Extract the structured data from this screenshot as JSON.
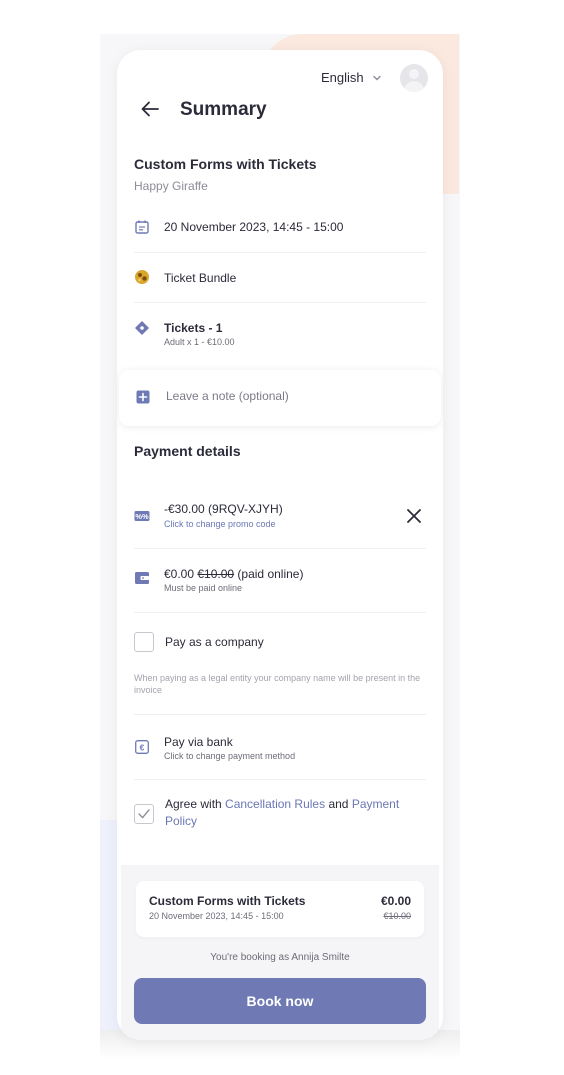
{
  "header": {
    "language": "English",
    "title": "Summary"
  },
  "event": {
    "title": "Custom Forms with Tickets",
    "organizer": "Happy Giraffe",
    "date_time": "20 November 2023, 14:45 - 15:00",
    "bundle": "Ticket Bundle",
    "tickets_label": "Tickets - 1",
    "tickets_detail": "Adult x 1 - €10.00"
  },
  "note": {
    "placeholder": "Leave a note (optional)"
  },
  "payment": {
    "title": "Payment details",
    "promo_value": "-€30.00 (9RQV-XJYH)",
    "promo_sub": "Click to change promo code",
    "price_now": "€0.00",
    "price_old": "€10.00",
    "price_suffix": "(paid online)",
    "price_sub": "Must be paid online",
    "company_label": "Pay as a company",
    "company_note": "When paying as a legal entity your company name will be present in the invoice",
    "method_label": "Pay via bank",
    "method_sub": "Click to change payment method",
    "agree_prefix": "Agree with",
    "agree_link1": "Cancellation Rules",
    "agree_and": "and",
    "agree_link2": "Payment Policy",
    "agree_checked": true,
    "company_checked": false
  },
  "footer": {
    "summary_name": "Custom Forms with Tickets",
    "summary_date": "20 November 2023, 14:45 - 15:00",
    "summary_price": "€0.00",
    "summary_old_price": "€10.00",
    "booking_as": "You're booking as Annija Smilte",
    "book_button": "Book now"
  },
  "colors": {
    "accent": "#6f7ab5",
    "link": "#6b77b5",
    "text": "#2b2b3a",
    "muted": "#8c8c98"
  },
  "icons": {
    "language": "chevron-down-icon",
    "avatar": "user-avatar-icon",
    "back": "arrow-left-icon",
    "date": "calendar-icon",
    "bundle": "bundle-icon",
    "tickets": "ticket-icon",
    "note": "note-add-icon",
    "promo": "promo-percent-icon",
    "price": "wallet-icon",
    "method": "euro-icon",
    "close": "close-icon"
  }
}
